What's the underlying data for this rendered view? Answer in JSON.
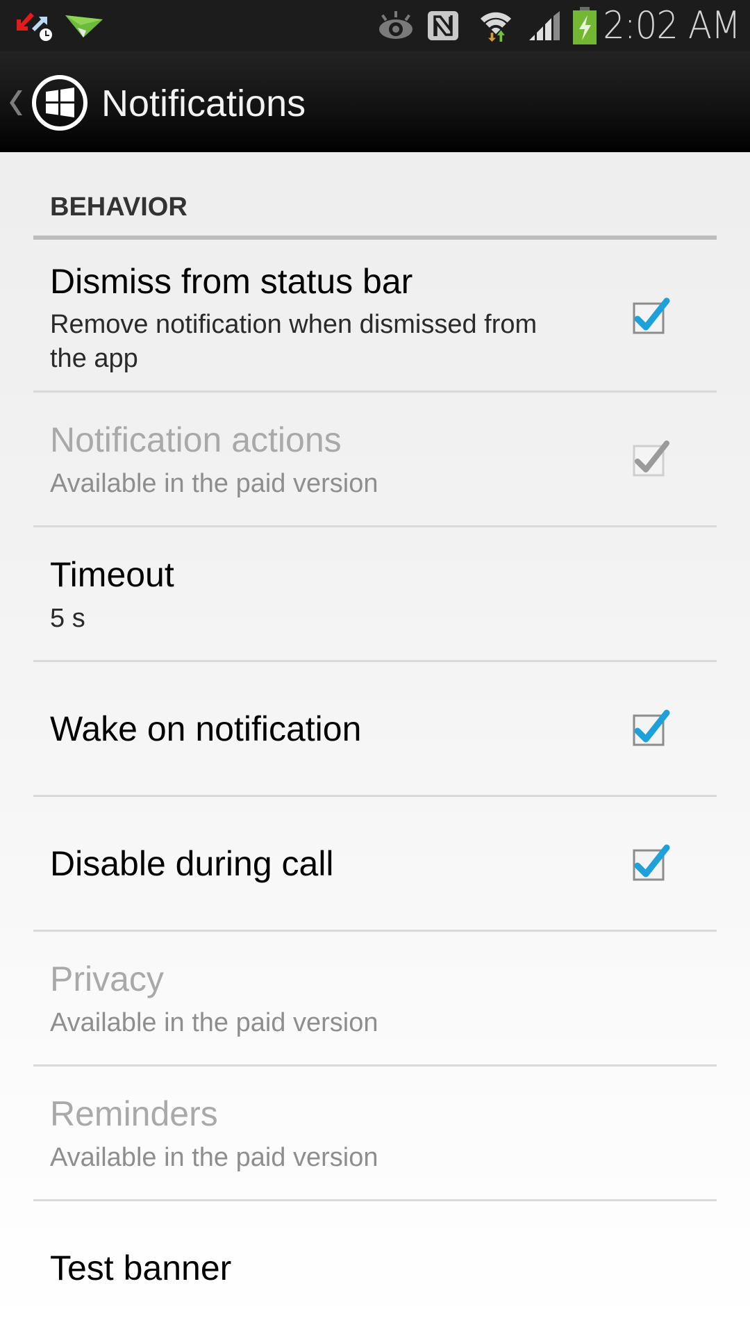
{
  "status_bar": {
    "left_icons": [
      "sync-transfer-icon",
      "airdroid-paper-plane-icon"
    ],
    "right_icons": [
      "eye-icon",
      "nfc-icon",
      "wifi-data-icon",
      "cell-signal-icon",
      "battery-charging-icon"
    ],
    "time": "2:02 AM"
  },
  "action_bar": {
    "title": "Notifications",
    "up_icon": "chevron-left-icon",
    "logo_icon": "windows-logo-icon"
  },
  "colors": {
    "accent_check": "#1ea0d8",
    "disabled_text": "#a9a9a9",
    "action_bar_bg": "#000000"
  },
  "category": {
    "title": "BEHAVIOR"
  },
  "preferences": [
    {
      "title": "Dismiss from status bar",
      "summary": "Remove notification when dismissed from the app",
      "checkbox": true,
      "checked": true,
      "enabled": true
    },
    {
      "title": "Notification actions",
      "summary": "Available in the paid version",
      "checkbox": true,
      "checked": true,
      "enabled": false
    },
    {
      "title": "Timeout",
      "summary": "5 s",
      "checkbox": false,
      "enabled": true
    },
    {
      "title": "Wake on notification",
      "summary": "",
      "checkbox": true,
      "checked": true,
      "enabled": true
    },
    {
      "title": "Disable during call",
      "summary": "",
      "checkbox": true,
      "checked": true,
      "enabled": true
    },
    {
      "title": "Privacy",
      "summary": "Available in the paid version",
      "checkbox": false,
      "enabled": false
    },
    {
      "title": "Reminders",
      "summary": "Available in the paid version",
      "checkbox": false,
      "enabled": false
    },
    {
      "title": "Test banner",
      "summary": "",
      "checkbox": false,
      "enabled": true
    }
  ]
}
